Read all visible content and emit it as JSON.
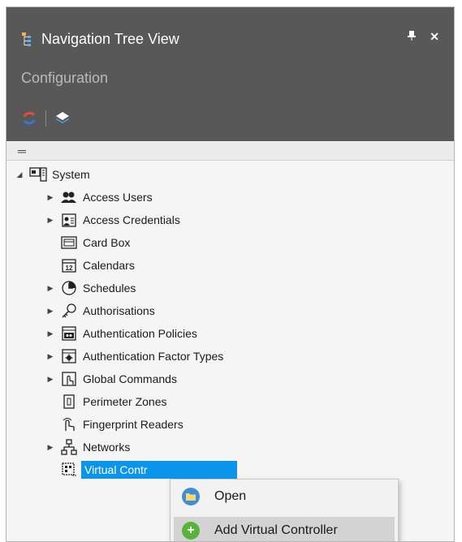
{
  "panel": {
    "title": "Navigation Tree View",
    "pin_glyph": "⬇",
    "close_glyph": "✕",
    "subtitle": "Configuration",
    "filter_glyph": "═"
  },
  "toolbar": {
    "icons": [
      "refresh-icon",
      "layers-icon"
    ]
  },
  "tree": {
    "root": {
      "label": "System",
      "expanded": true,
      "icon": "system-icon"
    },
    "items": [
      {
        "label": "Access Users",
        "has_children": true,
        "icon": "users-icon"
      },
      {
        "label": "Access Credentials",
        "has_children": true,
        "icon": "credentials-icon"
      },
      {
        "label": "Card Box",
        "has_children": false,
        "icon": "card-box-icon"
      },
      {
        "label": "Calendars",
        "has_children": false,
        "icon": "calendar-icon"
      },
      {
        "label": "Schedules",
        "has_children": true,
        "icon": "clock-icon"
      },
      {
        "label": "Authorisations",
        "has_children": true,
        "icon": "key-icon"
      },
      {
        "label": "Authentication Policies",
        "has_children": true,
        "icon": "policy-icon"
      },
      {
        "label": "Authentication Factor Types",
        "has_children": true,
        "icon": "factor-icon"
      },
      {
        "label": "Global Commands",
        "has_children": true,
        "icon": "command-icon"
      },
      {
        "label": "Perimeter Zones",
        "has_children": false,
        "icon": "zone-icon"
      },
      {
        "label": "Fingerprint Readers",
        "has_children": false,
        "icon": "fingerprint-icon"
      },
      {
        "label": "Networks",
        "has_children": true,
        "icon": "network-icon"
      },
      {
        "label": "Virtual Contr",
        "has_children": false,
        "icon": "controller-icon",
        "selected": true
      }
    ]
  },
  "context_menu": {
    "items": [
      {
        "label": "Open",
        "icon": "open-icon",
        "color": "#3a8fd8"
      },
      {
        "label": "Add Virtual Controller",
        "icon": "add-icon",
        "color": "#59b33a"
      }
    ]
  },
  "colors": {
    "header_bg": "#585858",
    "selection": "#0b95ea",
    "menu_hover": "#d3d3d3"
  }
}
